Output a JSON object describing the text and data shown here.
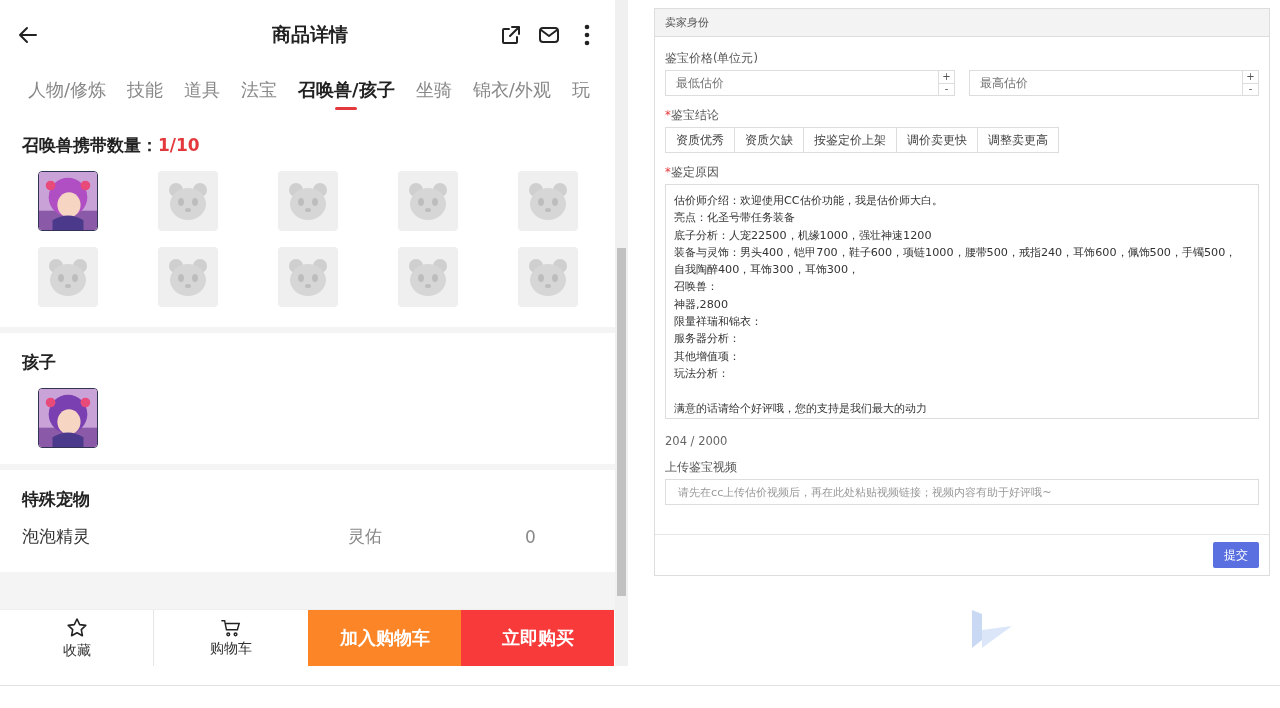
{
  "header": {
    "title": "商品详情"
  },
  "tabs": [
    {
      "label": "人物/修炼",
      "selected": false
    },
    {
      "label": "技能",
      "selected": false
    },
    {
      "label": "道具",
      "selected": false
    },
    {
      "label": "法宝",
      "selected": false
    },
    {
      "label": "召唤兽/孩子",
      "selected": true
    },
    {
      "label": "坐骑",
      "selected": false
    },
    {
      "label": "锦衣/外观",
      "selected": false
    },
    {
      "label": "玩",
      "selected": false
    }
  ],
  "summons": {
    "label": "召唤兽携带数量：",
    "count": "1/10",
    "slots": [
      {
        "kind": "pet"
      },
      {
        "kind": "empty"
      },
      {
        "kind": "empty"
      },
      {
        "kind": "empty"
      },
      {
        "kind": "empty"
      },
      {
        "kind": "empty"
      },
      {
        "kind": "empty"
      },
      {
        "kind": "empty"
      },
      {
        "kind": "empty"
      },
      {
        "kind": "empty"
      }
    ]
  },
  "children": {
    "title": "孩子",
    "slots": [
      {
        "kind": "child"
      }
    ]
  },
  "special_pets": {
    "title": "特殊宠物",
    "rows": [
      {
        "name": "泡泡精灵",
        "attribute": "灵佑",
        "value": "0"
      }
    ]
  },
  "bottom_bar": {
    "favorite": "收藏",
    "cart": "购物车",
    "add_to_cart": "加入购物车",
    "buy_now": "立即购买"
  },
  "appraisal": {
    "header": "卖家身份",
    "price_label": "鉴宝价格(单位元)",
    "min_placeholder": "最低估价",
    "max_placeholder": "最高估价",
    "plus": "+",
    "minus": "-",
    "conclusion_label": {
      "mark": "*",
      "text": "鉴宝结论"
    },
    "conclusions": [
      {
        "label": "资质优秀",
        "selected": false
      },
      {
        "label": "资质欠缺",
        "selected": false
      },
      {
        "label": "按鉴定价上架",
        "selected": false
      },
      {
        "label": "调价卖更快",
        "selected": false
      },
      {
        "label": "调整卖更高",
        "selected": false
      }
    ],
    "reason_label": {
      "mark": "*",
      "text": "鉴定原因"
    },
    "reason_blocks": [
      {
        "lines": [
          "估价师介绍：欢迎使用CC估价功能，我是估价师大白。",
          "亮点：化圣号带任务装备",
          "底子分析：人宠22500，机缘1000，强壮神速1200",
          "装备与灵饰：男头400，铠甲700，鞋子600，项链1000，腰带500，戒指240，耳饰600，佩饰500，手镯500，",
          "自我陶醉400，耳饰300，耳饰300，",
          "召唤兽：",
          "神器,2800",
          "限量祥瑞和锦衣：",
          "服务器分析：",
          "其他增值项：",
          "玩法分析："
        ]
      },
      {
        "lines": [
          "满意的话请给个好评哦，您的支持是我们最大的动力"
        ]
      }
    ],
    "counter": "204 / 2000",
    "video_label": "上传鉴宝视频",
    "video_placeholder": "请先在cc上传估价视频后，再在此处粘贴视频链接；视频内容有助于好评哦~",
    "submit": "提交"
  }
}
